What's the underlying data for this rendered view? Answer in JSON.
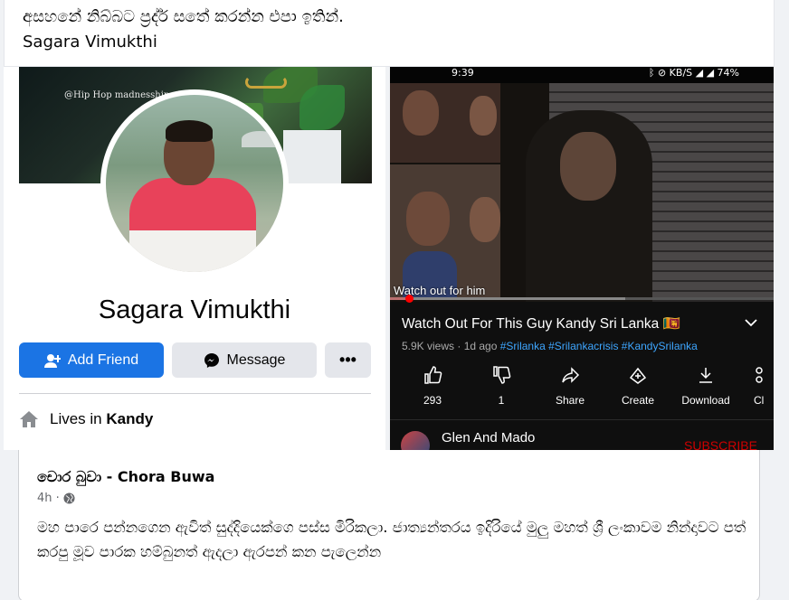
{
  "post": {
    "text_line1": "අසහනේ නිබ්බට ප්‍රද්ර් සතේ කරන්න එපා ඉතින්.",
    "text_line2": "Sagara Vimukthi"
  },
  "profile_card": {
    "watermark": "@Hip Hop madnesship",
    "name": "Sagara Vimukthi",
    "add_friend_label": "Add Friend",
    "message_label": "Message",
    "more_label": "•••",
    "lives_prefix": "Lives in ",
    "lives_city": "Kandy"
  },
  "youtube": {
    "status_time": "9:39",
    "status_right": "ᛒ ⊘ KB/S ◢ ◢ 74%",
    "overlay_text": "Watch out for him",
    "title": "Watch Out For This Guy Kandy Sri Lanka",
    "flag": "🇱🇰",
    "views": "5.9K views · 1d ago ",
    "tags": "#Srilanka #Srilankacrisis #KandySrilanka",
    "progress_fraction": 0.05,
    "actions": [
      {
        "icon": "thumbs-up-icon",
        "label": "293"
      },
      {
        "icon": "thumbs-down-icon",
        "label": "1"
      },
      {
        "icon": "share-icon",
        "label": "Share"
      },
      {
        "icon": "create-icon",
        "label": "Create"
      },
      {
        "icon": "download-icon",
        "label": "Download"
      },
      {
        "icon": "clip-icon",
        "label": "Cl"
      }
    ],
    "channel_name": "Glen And Mado",
    "subscribe_label": "SUBSCRIBE"
  },
  "shared_post": {
    "author": "චොර බුවා - Chora Buwa",
    "time": "4h · ",
    "body": "මහ පාරෙ පන්නගෙන ඇවිත් සුද්දියෙක්ගෙ පස්ස මිරිකලා. ජාත්‍යන්තරය ඉදිරියේ මුලු මහත් ශ්‍රී ලංකාවම නින්දාවට පත් කරපු මූව පාරක හම්බුනත් ඇදලා ඇරපන් කන පැලෙන්න"
  },
  "colors": {
    "fb_blue": "#1b74e4",
    "yt_red": "#ff0000",
    "yt_link": "#3ea6ff"
  }
}
